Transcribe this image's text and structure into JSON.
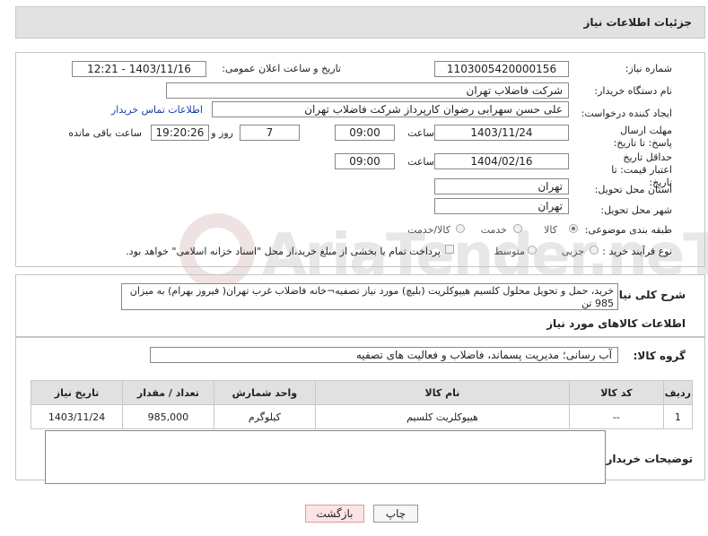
{
  "title": "جزئیات اطلاعات نیاز",
  "need_number": {
    "label": "شماره نیاز:",
    "value": "1103005420000156"
  },
  "announce_datetime": {
    "label": "تاریخ و ساعت اعلان عمومی:",
    "value": "1403/11/16 - 12:21"
  },
  "buyer_org": {
    "label": "نام دستگاه خریدار:",
    "value": "شرکت فاضلاب تهران"
  },
  "requester": {
    "label": "ایجاد کننده درخواست:",
    "value": "علی حسن  سهرابی رضوان کارپرداز شرکت فاضلاب تهران",
    "contact_link": "اطلاعات تماس خریدار"
  },
  "reply_deadline": {
    "label": "مهلت ارسال پاسخ: تا تاریخ:",
    "date": "1403/11/24",
    "time_label": "ساعت",
    "time": "09:00",
    "days": "7",
    "days_label": "روز و",
    "remaining": "19:20:26",
    "remaining_label": "ساعت باقی مانده"
  },
  "price_validity": {
    "label": "حداقل تاریخ اعتبار قیمت: تا تاریخ:",
    "date": "1404/02/16",
    "time_label": "ساعت",
    "time": "09:00"
  },
  "province": {
    "label": "استان محل تحویل:",
    "value": "تهران"
  },
  "city": {
    "label": "شهر محل تحویل:",
    "value": "تهران"
  },
  "category": {
    "label": "طبقه بندی موضوعی:",
    "options": [
      "کالا",
      "خدمت",
      "کالا/خدمت"
    ],
    "selected": "کالا"
  },
  "purchase_process": {
    "label": "نوع فرآیند خرید :",
    "options": [
      "جزیی",
      "متوسط"
    ],
    "note": "پرداخت تمام یا بخشی از مبلغ خرید،از محل \"اسناد خزانه اسلامی\" خواهد بود."
  },
  "description": {
    "label": "شرح کلی نیاز:",
    "value": "خرید، حمل و تحویل محلول کلسیم هیپوکلریت (بلیچ) مورد نیاز تصفیه¬خانه فاضلاب غرب تهران( فیروز بهرام) به میزان 985 تن"
  },
  "goods_section_title": "اطلاعات کالاهای مورد نیاز",
  "goods_group": {
    "label": "گروه کالا:",
    "value": "آب رسانی؛ مدیریت پسماند، فاضلاب و فعالیت های تصفیه"
  },
  "table": {
    "headers": [
      "ردیف",
      "کد کالا",
      "نام کالا",
      "واحد شمارش",
      "تعداد / مقدار",
      "تاریخ نیاز"
    ],
    "rows": [
      [
        "1",
        "--",
        "هیپوکلریت کلسیم",
        "کیلوگرم",
        "985,000",
        "1403/11/24"
      ]
    ]
  },
  "buyer_notes": {
    "label": "توضیحات خریدار:",
    "value": ""
  },
  "buttons": {
    "print": "چاپ",
    "back": "بازگشت"
  },
  "watermark": "AriaTender.neT"
}
